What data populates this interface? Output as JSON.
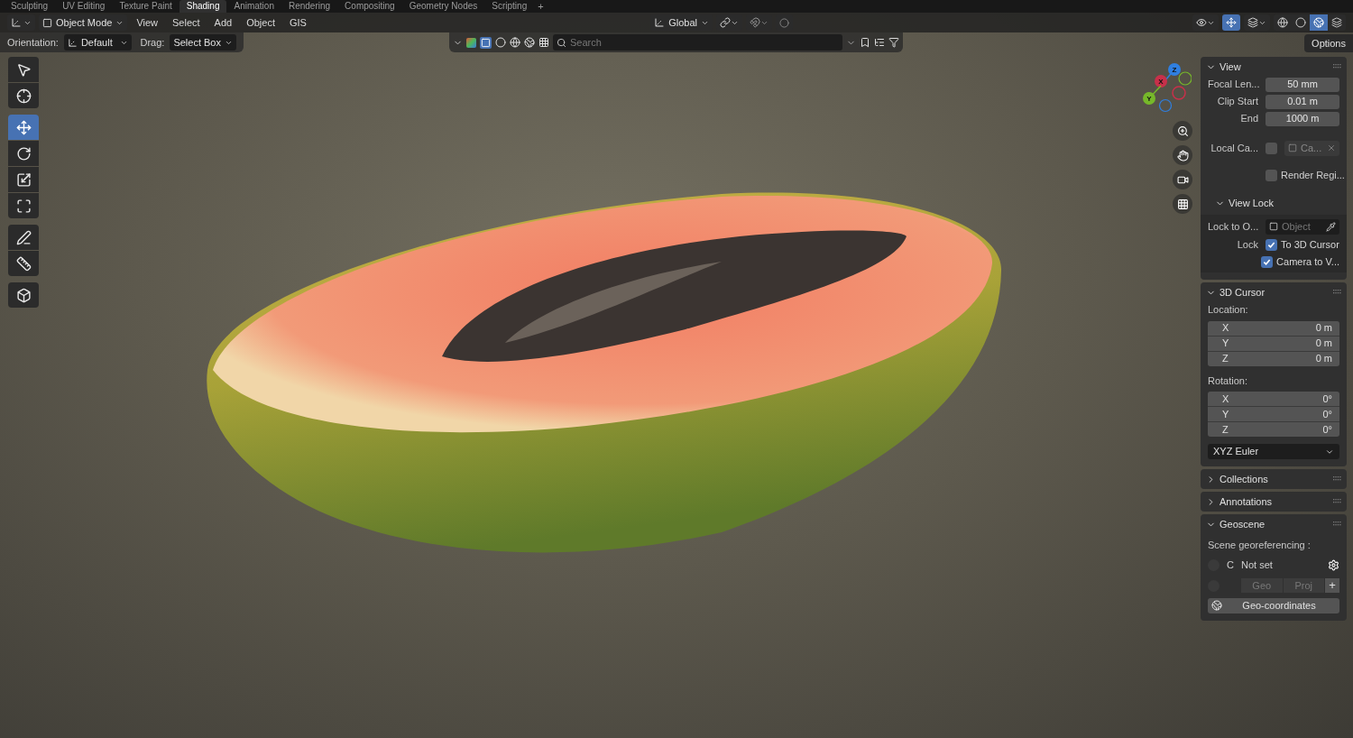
{
  "workspace_tabs": [
    {
      "label": "Sculpting",
      "selected": false
    },
    {
      "label": "UV Editing",
      "selected": false
    },
    {
      "label": "Texture Paint",
      "selected": false
    },
    {
      "label": "Shading",
      "selected": true
    },
    {
      "label": "Animation",
      "selected": false
    },
    {
      "label": "Rendering",
      "selected": false
    },
    {
      "label": "Compositing",
      "selected": false
    },
    {
      "label": "Geometry Nodes",
      "selected": false
    },
    {
      "label": "Scripting",
      "selected": false
    }
  ],
  "add_workspace": "+",
  "header": {
    "mode": "Object Mode",
    "menus": [
      "View",
      "Select",
      "Add",
      "Object",
      "GIS"
    ],
    "transform_orientation": "Global",
    "gizmos_on": true,
    "shading_modes": [
      {
        "kind": "wireframe",
        "selected": false
      },
      {
        "kind": "solid",
        "selected": false
      },
      {
        "kind": "material",
        "selected": true
      },
      {
        "kind": "rendered",
        "selected": false
      }
    ]
  },
  "tool_settings": {
    "orientation_label": "Orientation:",
    "orientation": "Default",
    "drag_label": "Drag:",
    "drag": "Select Box",
    "search_placeholder": "Search",
    "options": "Options"
  },
  "toolbar": [
    {
      "tools": [
        {
          "kind": "select",
          "selected": false
        },
        {
          "kind": "cursor",
          "selected": false
        }
      ]
    },
    {
      "tools": [
        {
          "kind": "move",
          "selected": true
        },
        {
          "kind": "rotate",
          "selected": false
        },
        {
          "kind": "scale",
          "selected": false
        },
        {
          "kind": "transform",
          "selected": false
        }
      ]
    },
    {
      "tools": [
        {
          "kind": "annotate",
          "selected": false
        },
        {
          "kind": "measure",
          "selected": false
        }
      ]
    },
    {
      "tools": [
        {
          "kind": "add_cube",
          "selected": false
        }
      ]
    }
  ],
  "navigation_gizmo": {
    "axes": [
      {
        "kind": "z",
        "label": "Z",
        "color": "#2f7fe0"
      },
      {
        "kind": "x",
        "label": "X",
        "color": "#c8304a"
      },
      {
        "kind": "y",
        "label": "Y",
        "color": "#76b82a"
      }
    ]
  },
  "sidebar": [
    {
      "kind": "view",
      "title": "View",
      "expanded": true,
      "fields": [
        {
          "label": "Focal Len...",
          "value": "50 mm"
        },
        {
          "label": "Clip Start",
          "value": "0.01 m"
        },
        {
          "label": "End",
          "value": "1000 m"
        }
      ],
      "local_camera": {
        "label": "Local Ca...",
        "checked": false,
        "object": "Ca..."
      },
      "render_region": {
        "label": "Render Regi...",
        "checked": false
      },
      "view_lock": {
        "title": "View Lock",
        "expanded": true,
        "lock_to_label": "Lock to O...",
        "lock_to_placeholder": "Object",
        "lock_label": "Lock",
        "options": [
          {
            "label": "To 3D Cursor",
            "checked": true
          },
          {
            "label": "Camera to V...",
            "checked": true
          }
        ]
      }
    },
    {
      "kind": "cursor",
      "title": "3D Cursor",
      "expanded": true,
      "location_label": "Location:",
      "location": [
        {
          "axis": "X",
          "value": "0 m"
        },
        {
          "axis": "Y",
          "value": "0 m"
        },
        {
          "axis": "Z",
          "value": "0 m"
        }
      ],
      "rotation_label": "Rotation:",
      "rotation": [
        {
          "axis": "X",
          "value": "0°"
        },
        {
          "axis": "Y",
          "value": "0°"
        },
        {
          "axis": "Z",
          "value": "0°"
        }
      ],
      "rotation_mode": "XYZ Euler"
    },
    {
      "kind": "collapsed",
      "title": "Collections",
      "expanded": false
    },
    {
      "kind": "collapsed",
      "title": "Annotations",
      "expanded": false
    },
    {
      "kind": "geoscene",
      "title": "Geoscene",
      "expanded": true,
      "caption": "Scene georeferencing :",
      "crs_letter": "C",
      "crs_value": "Not set",
      "radios": [
        {
          "selected": false
        },
        {
          "selected": false
        }
      ],
      "buttons": [
        "Geo",
        "Proj"
      ],
      "add": "+",
      "geo_coordinates": "Geo-coordinates"
    }
  ]
}
